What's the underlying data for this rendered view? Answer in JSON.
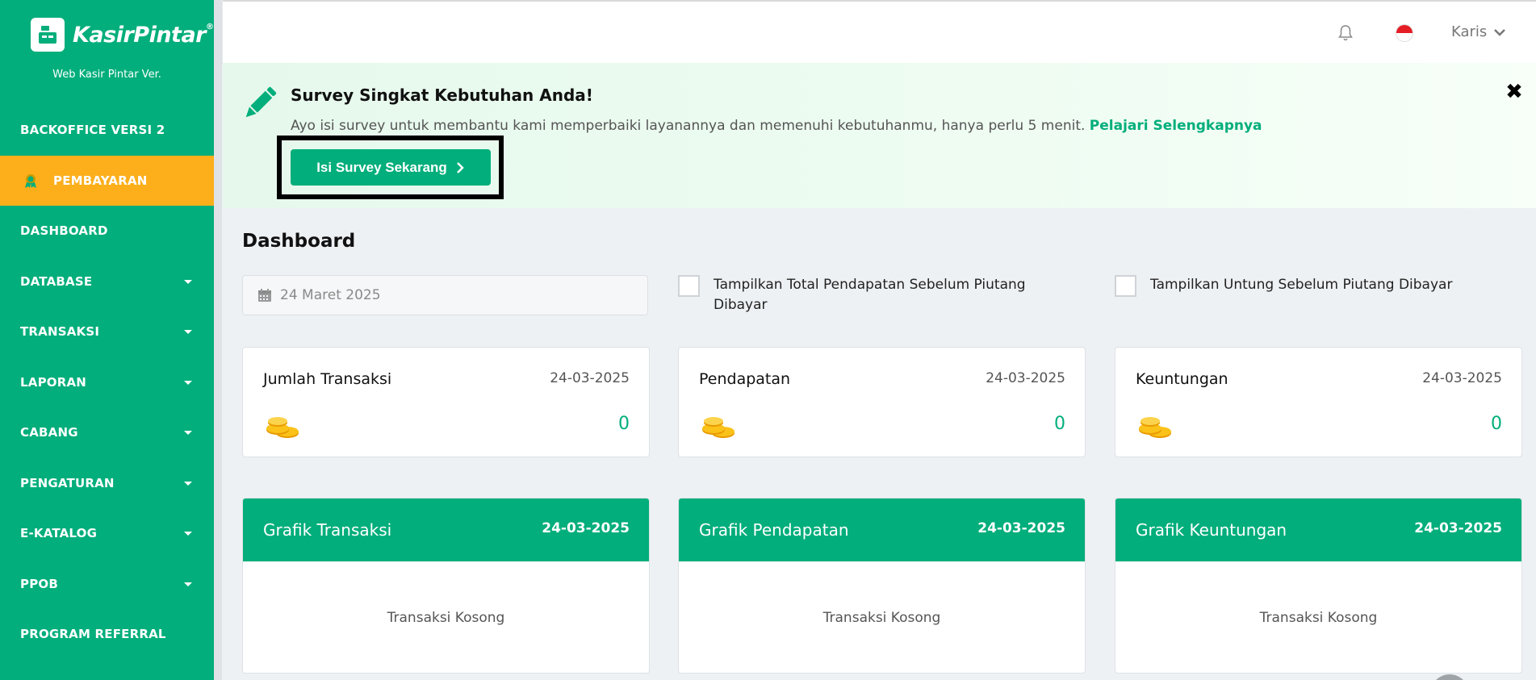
{
  "brand": {
    "logo_text": "KasirPintar",
    "trademark": "®",
    "version": "Web Kasir Pintar Ver."
  },
  "sidebar": {
    "items": [
      {
        "label": "BACKOFFICE VERSI 2",
        "dropdown": false,
        "active": false
      },
      {
        "label": "PEMBAYARAN",
        "dropdown": false,
        "active": true
      },
      {
        "label": "DASHBOARD",
        "dropdown": false,
        "active": false
      },
      {
        "label": "DATABASE",
        "dropdown": true,
        "active": false
      },
      {
        "label": "TRANSAKSI",
        "dropdown": true,
        "active": false
      },
      {
        "label": "LAPORAN",
        "dropdown": true,
        "active": false
      },
      {
        "label": "CABANG",
        "dropdown": true,
        "active": false
      },
      {
        "label": "PENGATURAN",
        "dropdown": true,
        "active": false
      },
      {
        "label": "E-KATALOG",
        "dropdown": true,
        "active": false
      },
      {
        "label": "PPOB",
        "dropdown": true,
        "active": false
      },
      {
        "label": "PROGRAM REFERRAL",
        "dropdown": false,
        "active": false
      }
    ]
  },
  "header": {
    "user_name": "Karis",
    "icons": [
      "bell-icon",
      "indonesia-flag-icon",
      "chevron-down-icon"
    ]
  },
  "banner": {
    "title": "Survey Singkat Kebutuhan Anda!",
    "text": "Ayo isi survey untuk membantu kami memperbaiki layanannya dan memenuhi kebutuhanmu, hanya perlu 5 menit.",
    "link": "Pelajari Selengkapnya",
    "button": "Isi Survey Sekarang",
    "close": "✖"
  },
  "dashboard": {
    "title": "Dashboard",
    "date_value": "24 Maret 2025",
    "checkbox_1": "Tampilkan Total Pendapatan Sebelum Piutang Dibayar",
    "checkbox_2": "Tampilkan Untung Sebelum Piutang Dibayar",
    "stats": [
      {
        "label": "Jumlah Transaksi",
        "date": "24-03-2025",
        "value": "0"
      },
      {
        "label": "Pendapatan",
        "date": "24-03-2025",
        "value": "0"
      },
      {
        "label": "Keuntungan",
        "date": "24-03-2025",
        "value": "0"
      }
    ],
    "graphs": [
      {
        "title": "Grafik Transaksi",
        "date": "24-03-2025",
        "empty": "Transaksi Kosong"
      },
      {
        "title": "Grafik Pendapatan",
        "date": "24-03-2025",
        "empty": "Transaksi Kosong"
      },
      {
        "title": "Grafik Keuntungan",
        "date": "24-03-2025",
        "empty": "Transaksi Kosong"
      }
    ]
  },
  "colors": {
    "brand_green": "#02ae7b",
    "active_orange": "#fcaf1b",
    "background": "#eef1f4"
  }
}
